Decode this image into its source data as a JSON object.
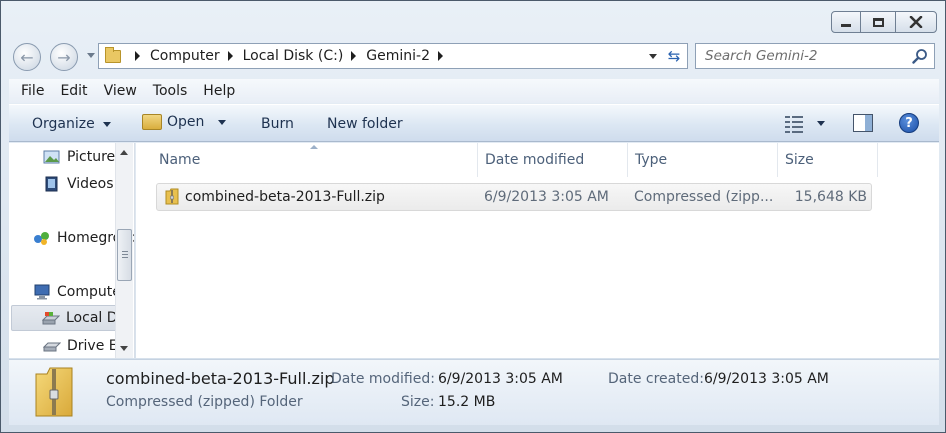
{
  "window": {
    "caption_buttons": [
      "minimize-icon",
      "maximize-icon",
      "close-icon"
    ]
  },
  "address": {
    "crumbs": [
      "Computer",
      "Local Disk (C:)",
      "Gemini-2"
    ]
  },
  "search": {
    "placeholder": "Search Gemini-2"
  },
  "menu": [
    "File",
    "Edit",
    "View",
    "Tools",
    "Help"
  ],
  "toolbar": {
    "organize": "Organize",
    "open": "Open",
    "burn": "Burn",
    "new_folder": "New folder"
  },
  "nav": {
    "items": [
      {
        "label": "Pictures",
        "icon": "pictures-icon"
      },
      {
        "label": "Videos",
        "icon": "videos-icon"
      },
      {
        "label": "Homegroup",
        "icon": "homegroup-icon"
      },
      {
        "label": "Computer",
        "icon": "computer-icon"
      },
      {
        "label": "Local Disk (C:)",
        "icon": "local-disk-icon",
        "selected": true
      },
      {
        "label": "Drive E",
        "icon": "drive-icon"
      }
    ]
  },
  "columns": {
    "name": "Name",
    "date": "Date modified",
    "type": "Type",
    "size": "Size"
  },
  "files": [
    {
      "name": "combined-beta-2013-Full.zip",
      "date": "6/9/2013 3:05 AM",
      "type": "Compressed (zipp...",
      "size": "15,648 KB"
    }
  ],
  "details": {
    "name": "combined-beta-2013-Full.zip",
    "type": "Compressed (zipped) Folder",
    "date_modified_label": "Date modified:",
    "date_modified": "6/9/2013 3:05 AM",
    "date_created_label": "Date created:",
    "date_created": "6/9/2013 3:05 AM",
    "size_label": "Size:",
    "size": "15.2 MB"
  }
}
